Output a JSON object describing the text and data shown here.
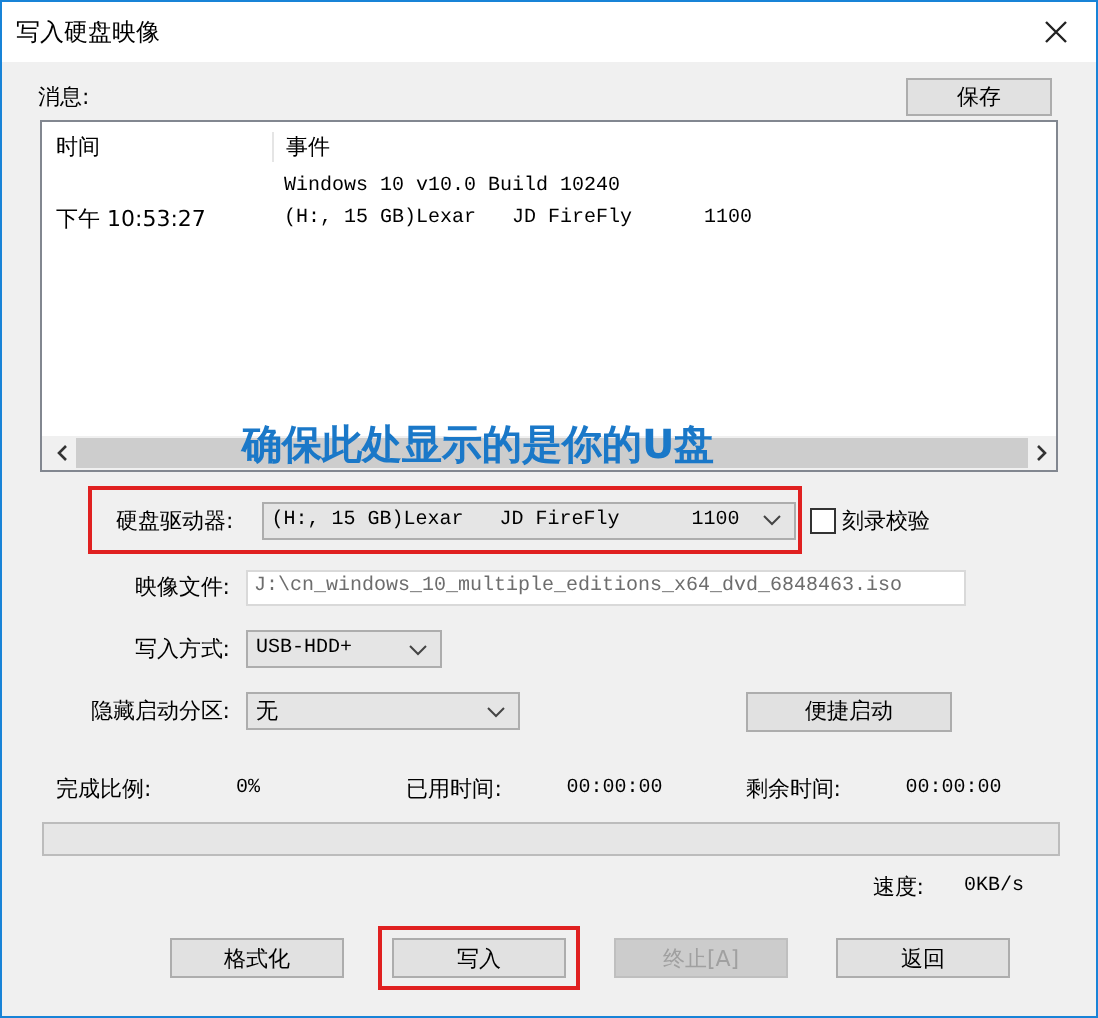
{
  "window": {
    "title": "写入硬盘映像"
  },
  "messages": {
    "label": "消息:",
    "save_button": "保存",
    "columns": [
      "时间",
      "事件"
    ],
    "rows": [
      {
        "event": "Windows 10 v10.0 Build 10240"
      },
      {
        "time": "下午 10:53:27",
        "event": "(H:, 15 GB)Lexar   JD FireFly      1100"
      }
    ]
  },
  "annotation": {
    "text": "确保此处显示的是你的U盘"
  },
  "form": {
    "drive": {
      "label": "硬盘驱动器:",
      "value": "(H:, 15 GB)Lexar   JD FireFly      1100",
      "highlighted": true
    },
    "verify": {
      "label": "刻录校验",
      "checked": false
    },
    "image_file": {
      "label": "映像文件:",
      "value": "J:\\cn_windows_10_multiple_editions_x64_dvd_6848463.iso"
    },
    "write_mode": {
      "label": "写入方式:",
      "value": "USB-HDD+"
    },
    "hidden_partition": {
      "label": "隐藏启动分区:",
      "value": "无"
    },
    "quick_boot": "便捷启动"
  },
  "progress": {
    "items": [
      {
        "label": "完成比例:",
        "value": "0%"
      },
      {
        "label": "已用时间:",
        "value": "00:00:00"
      },
      {
        "label": "剩余时间:",
        "value": "00:00:00"
      }
    ],
    "level": 0,
    "speed_label": "速度:",
    "speed": "0KB/s"
  },
  "buttons": [
    {
      "label": "格式化",
      "disabled": false,
      "highlighted": false
    },
    {
      "label": "写入",
      "disabled": false,
      "highlighted": true
    },
    {
      "label": "终止[A]",
      "disabled": true,
      "highlighted": false
    },
    {
      "label": "返回",
      "disabled": false,
      "highlighted": false
    }
  ]
}
